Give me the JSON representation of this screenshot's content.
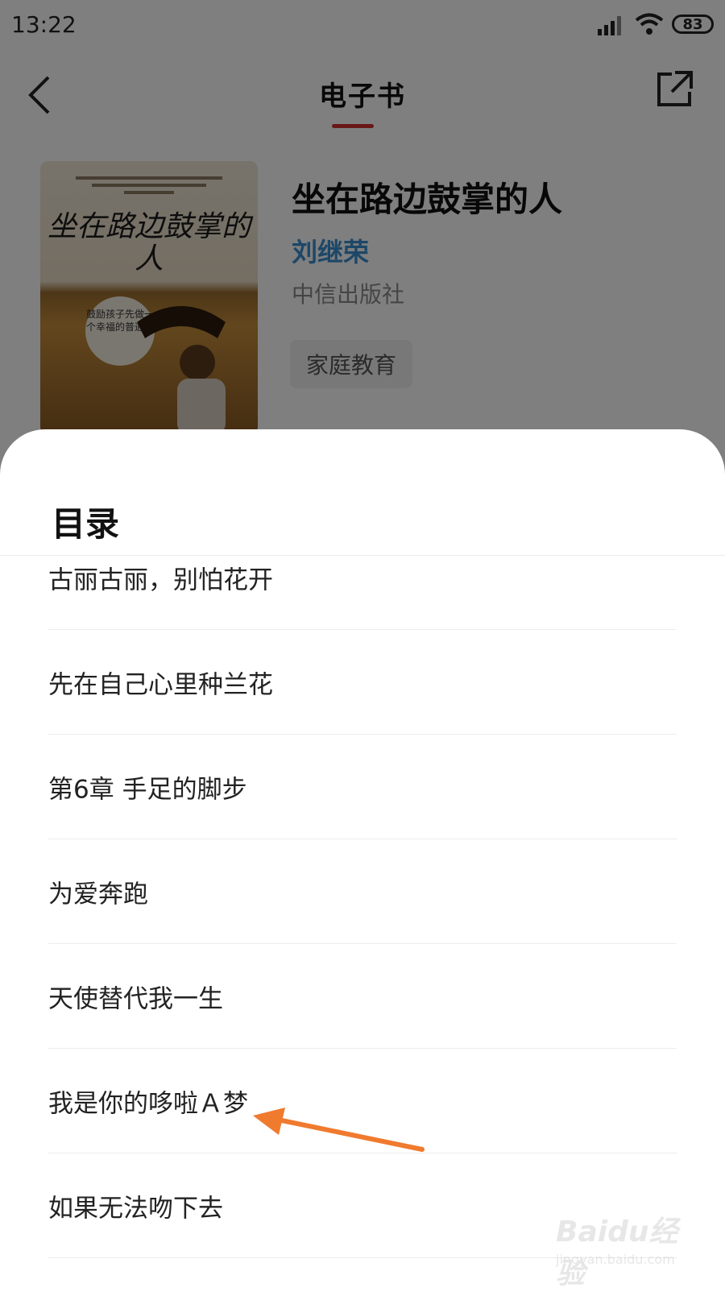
{
  "status_bar": {
    "time": "13:22",
    "battery": "83"
  },
  "app_bar": {
    "title": "电子书"
  },
  "book": {
    "cover_title": "坐在路边鼓掌的人",
    "cover_badge_text": "鼓励孩子先做一个幸福的普通人",
    "title": "坐在路边鼓掌的人",
    "author": "刘继荣",
    "publisher": "中信出版社",
    "tag": "家庭教育"
  },
  "toc": {
    "title": "目录",
    "items": [
      "古丽古丽，别怕花开",
      "先在自己心里种兰花",
      "第6章 手足的脚步",
      "为爱奔跑",
      "天使替代我一生",
      "我是你的哆啦Ａ梦",
      "如果无法吻下去"
    ]
  },
  "annotation": {
    "arrow_color": "#f07a2e"
  },
  "watermark": {
    "brand": "Baidu经验",
    "url": "jingyan.baidu.com"
  },
  "colors": {
    "accent": "#d32f2f",
    "author": "#3a8fd1"
  }
}
